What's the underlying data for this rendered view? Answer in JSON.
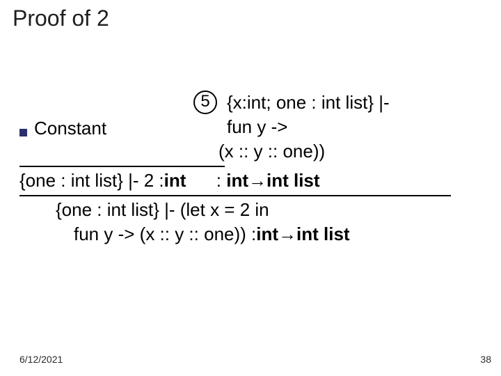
{
  "title": "Proof of 2",
  "circle": "5",
  "line1_right": "{x:int; one : int list} |-",
  "constant": "Constant",
  "line2_fun": "fun y ->",
  "line3_body": "(x :: y :: one))",
  "line4_left": "{one : int list} |- 2 : ",
  "line4_int1": "int",
  "line4_mid": "      : ",
  "line4_int2": "int",
  "line4_arrow": " → ",
  "line4_int3": "int list",
  "line5_a": "{one : int list} |-  (let x = 2 in",
  "line6_a": "fun y -> (x :: y :: one)) : ",
  "line6_int1": "int",
  "line6_arrow": " → ",
  "line6_int2": "int list",
  "date": "6/12/2021",
  "page": "38"
}
